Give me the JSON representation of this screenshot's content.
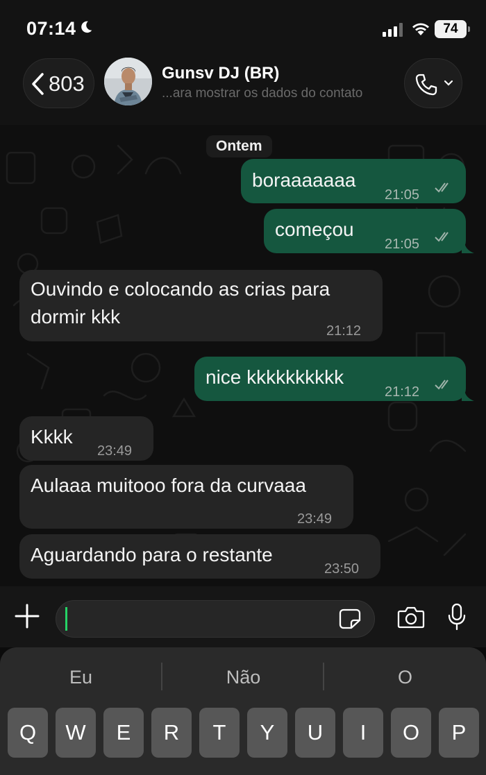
{
  "status_bar": {
    "time": "07:14",
    "battery": "74",
    "icons": [
      "moon-icon",
      "signal-icon",
      "wifi-icon",
      "battery-icon"
    ]
  },
  "header": {
    "back_count": "803",
    "contact_name": "Gunsv DJ (BR)",
    "contact_subtitle": "...ara mostrar os dados do contato",
    "icons": [
      "chevron-left-icon",
      "phone-icon",
      "chevron-down-icon"
    ]
  },
  "chat": {
    "date_label": "Ontem",
    "messages": [
      {
        "direction": "out",
        "text": "boraaaaaaa",
        "time": "21:05",
        "status": "read"
      },
      {
        "direction": "out",
        "text": "começou",
        "time": "21:05",
        "status": "read"
      },
      {
        "direction": "in",
        "text_lines": [
          "Ouvindo e colocando as crias para",
          "dormir kkk"
        ],
        "time": "21:12"
      },
      {
        "direction": "out",
        "text": "nice kkkkkkkkkk",
        "time": "21:12",
        "status": "read"
      },
      {
        "direction": "in",
        "text": "Kkkk",
        "time": "23:49"
      },
      {
        "direction": "in",
        "text": "Aulaaa muitooo fora da curvaaa",
        "time": "23:49"
      },
      {
        "direction": "in",
        "text": "Aguardando para o restante",
        "time": "23:50"
      }
    ]
  },
  "input_bar": {
    "value": "",
    "icons": [
      "plus-icon",
      "sticker-icon",
      "camera-icon",
      "microphone-icon"
    ]
  },
  "keyboard": {
    "suggestions": [
      "Eu",
      "Não",
      "O"
    ],
    "row1": [
      "Q",
      "W",
      "E",
      "R",
      "T",
      "Y",
      "U",
      "I",
      "O",
      "P"
    ]
  },
  "colors": {
    "outgoing_bubble": "#15573f",
    "incoming_bubble": "#252525",
    "accent": "#25d366",
    "background": "#0f0f0f"
  }
}
